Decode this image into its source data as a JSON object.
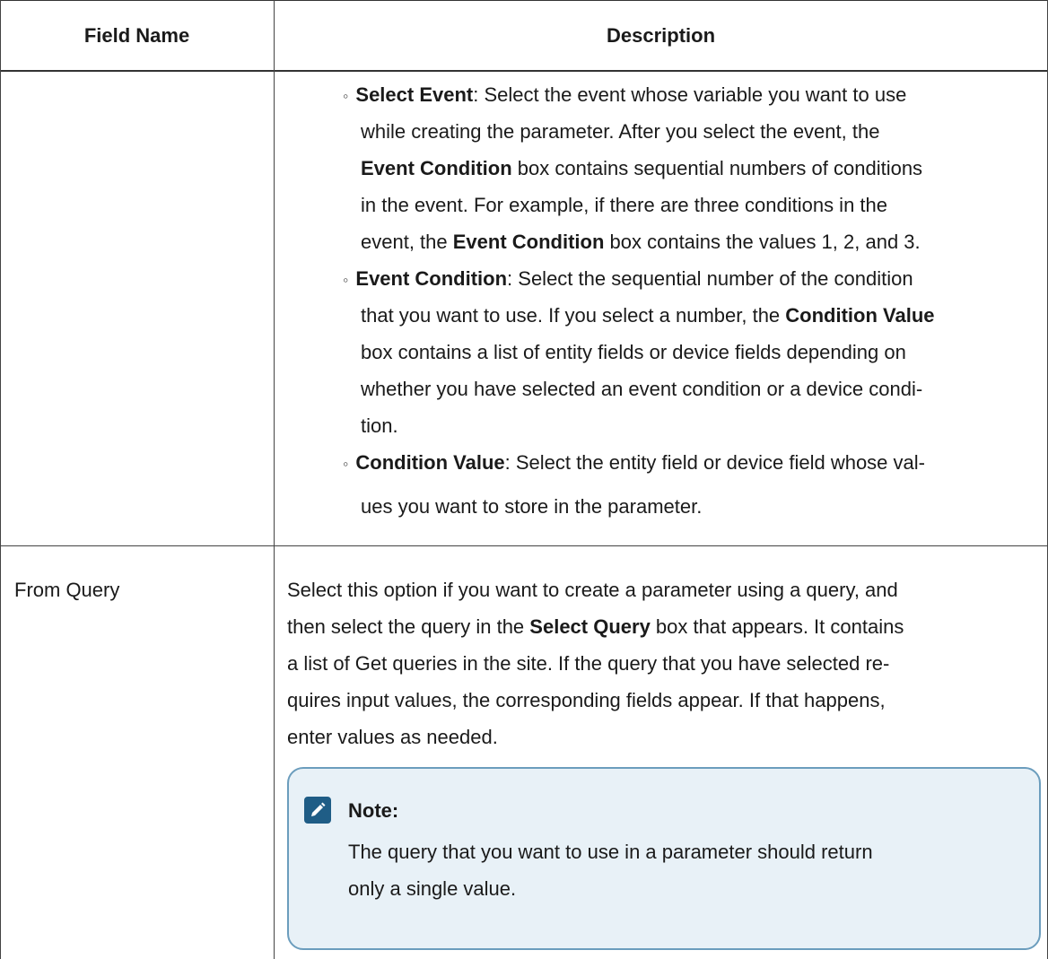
{
  "table": {
    "headers": {
      "field_name": "Field Name",
      "description": "Description"
    },
    "row1": {
      "bullets": [
        {
          "lines": [
            {
              "bold": "Select Event",
              "text": ": Select the event whose variable you want to use"
            },
            {
              "text": "while creating the parameter. After you select the event, the"
            },
            {
              "bold": "Event Condition",
              "text": " box contains sequential numbers of conditions"
            },
            {
              "text": "in the event. For example, if there are three conditions in the"
            },
            {
              "pre": "event, the ",
              "bold": "Event Condition",
              "text": " box contains the values 1, 2, and 3."
            }
          ]
        },
        {
          "lines": [
            {
              "bold": "Event Condition",
              "text": ": Select the sequential number of the condition"
            },
            {
              "pre": "that you want to use. If you select a number, the ",
              "bold": "Condition Value",
              "text": ""
            },
            {
              "text": "box contains a list of entity fields or device fields depending on"
            },
            {
              "text": "whether you have selected an event condition or a device condi-"
            },
            {
              "text": "tion."
            }
          ]
        },
        {
          "lines": [
            {
              "bold": "Condition Value",
              "text": ": Select the entity field or device field whose val-"
            },
            {
              "text": "ues you want to store in the parameter."
            }
          ]
        }
      ]
    },
    "row2": {
      "field_name": "From Query",
      "lines": [
        {
          "text": "Select this option if you want to create a parameter using a query, and"
        },
        {
          "pre": "then select the query in the ",
          "bold": "Select Query",
          "text": " box that appears. It contains"
        },
        {
          "text": "a list of Get queries in the site. If the query that you have selected re-"
        },
        {
          "text": "quires input values, the corresponding fields appear. If that happens,"
        },
        {
          "text": "enter values as needed."
        }
      ],
      "note": {
        "icon": "pencil-icon",
        "title": "Note:",
        "lines": [
          "The query that you want to use in a parameter should return",
          "only a single value."
        ]
      }
    }
  },
  "colors": {
    "note_bg": "#e8f1f7",
    "note_border": "#6b9dbd",
    "icon_bg": "#1f5d86"
  }
}
